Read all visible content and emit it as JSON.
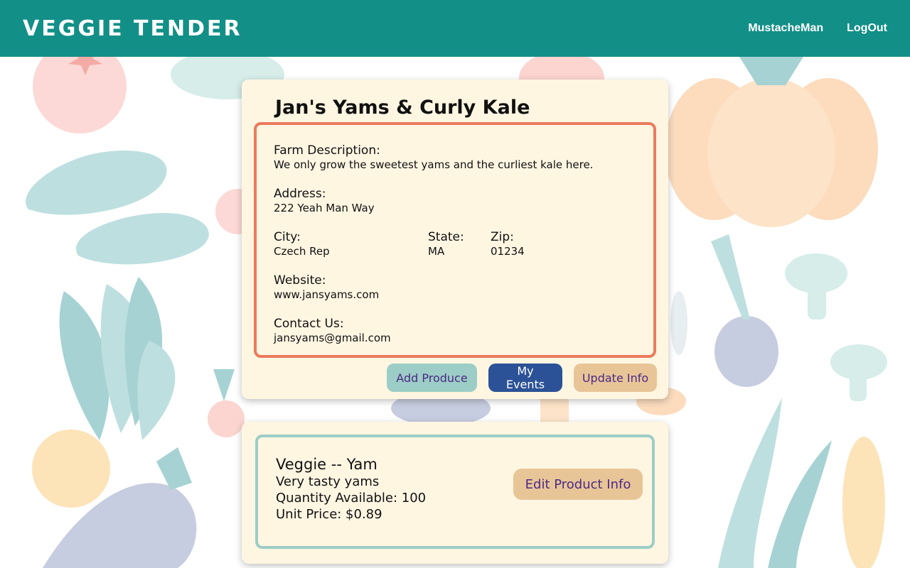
{
  "header": {
    "logo": "VEGGIE TENDER",
    "nav": [
      "MustacheMan",
      "LogOut"
    ]
  },
  "farm": {
    "name": "Jan's Yams & Curly Kale",
    "description_label": "Farm Description:",
    "description": "We only grow the sweetest yams and the curliest kale here.",
    "address_label": "Address:",
    "address": "222 Yeah Man Way",
    "city_label": "City:",
    "city": "Czech Rep",
    "state_label": "State:",
    "state": "MA",
    "zip_label": "Zip:",
    "zip": "01234",
    "website_label": "Website:",
    "website": "www.jansyams.com",
    "contact_label": "Contact Us:",
    "contact": "jansyams@gmail.com"
  },
  "actions": {
    "add_produce": "Add Produce",
    "my_events": "My Events",
    "update_info": "Update Info"
  },
  "product": {
    "title": "Veggie -- Yam",
    "description": "Very tasty yams",
    "quantity": "Quantity Available: 100",
    "price": "Unit Price: $0.89",
    "edit_label": "Edit Product Info"
  },
  "colors": {
    "header": "#128f87",
    "card": "#fff6e2",
    "farm_border": "#ec7a5c",
    "product_border": "#9ccdc6",
    "btn_add": "#9ccdc6",
    "btn_events": "#2b5296",
    "btn_update": "#e8c597"
  },
  "icons": [
    "tomato-illustration",
    "cucumber-illustration",
    "pumpkin-illustration",
    "chard-illustration",
    "radish-illustration",
    "eggplant-illustration",
    "onion-illustration",
    "mushroom-illustration",
    "corn-illustration"
  ]
}
